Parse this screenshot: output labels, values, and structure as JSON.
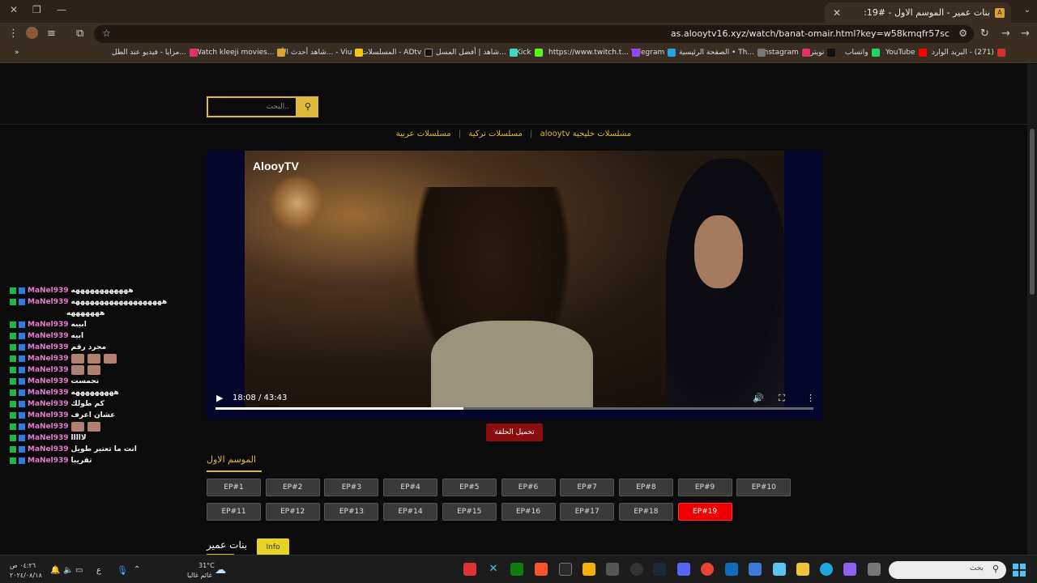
{
  "browser": {
    "tab_title": "بنات عمير - الموسم الاول - #19:",
    "tab_close": "✕",
    "new_tab": "+",
    "url": "as.alooytv16.xyz/watch/banat-omair.html?key=w58kmqfr57sc"
  },
  "bookmarks": [
    {
      "label": "البريد الوارد ‎- (271)",
      "color": "#d93025"
    },
    {
      "label": "YouTube",
      "color": "#ff0000"
    },
    {
      "label": "واتساب",
      "color": "#25d366"
    },
    {
      "label": "تويتر",
      "color": "#111111"
    },
    {
      "label": "Instagram",
      "color": "#e1306c"
    },
    {
      "label": "الصفحة الرئيسية • Th...",
      "color": "#777777"
    },
    {
      "label": "Telegram",
      "color": "#2aa3df"
    },
    {
      "label": "https://www.twitch.t...",
      "color": "#9146ff"
    },
    {
      "label": "Kick",
      "color": "#53fc18"
    },
    {
      "label": "شاهد | أفضل المسل...",
      "color": "#3cd7c5"
    },
    {
      "label": "المسلسلات - ADtv",
      "color": "#111111"
    },
    {
      "label": "شاهد أحدث الأع... - Viu",
      "color": "#f5c518"
    },
    {
      "label": "Watch kleeji movies...",
      "color": "#d8a534"
    },
    {
      "label": "مزايا - فيديو عند الطل...",
      "color": "#e1306c"
    }
  ],
  "site": {
    "search_placeholder": "البحث..",
    "search_icon": "🔍",
    "crumbs": [
      "alooytv مسلسلات خليجية",
      "مسلسلات عربية",
      "مسلسلات تركية"
    ],
    "crumb_sep": "|"
  },
  "video": {
    "logo": "AlooyTV",
    "time": "18:08 / 43:43",
    "progress": 0.414,
    "play_icon": "▶",
    "volume_icon": "🔊",
    "fullscreen_icon": "⛶",
    "more_icon": "⋮"
  },
  "download_label": "تحميل الحلقة",
  "season_title": "الموسم الاول",
  "episodes": [
    "EP#1",
    "EP#2",
    "EP#3",
    "EP#4",
    "EP#5",
    "EP#6",
    "EP#7",
    "EP#8",
    "EP#9",
    "EP#10",
    "EP#11",
    "EP#12",
    "EP#13",
    "EP#14",
    "EP#15",
    "EP#16",
    "EP#17",
    "EP#18",
    "EP#19"
  ],
  "active_episode": "EP#19",
  "show_title": "بنات عمير",
  "info_label": "Info",
  "chat": [
    {
      "user": "MaNel939",
      "text": "ههههههههههههه",
      "emotes": 0
    },
    {
      "user": "MaNel939",
      "text": "هههههههههههههههههههه",
      "emotes": 0
    },
    {
      "user": "",
      "text": "هههههههه",
      "emotes": 0
    },
    {
      "user": "MaNel939",
      "text": "ابيبه",
      "emotes": 0
    },
    {
      "user": "MaNel939",
      "text": "ابيه",
      "emotes": 0
    },
    {
      "user": "MaNel939",
      "text": "مجرد رقم",
      "emotes": 0
    },
    {
      "user": "MaNel939",
      "text": "",
      "emotes": 3
    },
    {
      "user": "MaNel939",
      "text": "",
      "emotes": 2
    },
    {
      "user": "MaNel939",
      "text": "تحمست",
      "emotes": 0
    },
    {
      "user": "MaNel939",
      "text": "هههههههههه",
      "emotes": 0
    },
    {
      "user": "MaNel939",
      "text": "كم طولك",
      "emotes": 0
    },
    {
      "user": "MaNel939",
      "text": "عشان اعرف",
      "emotes": 0
    },
    {
      "user": "MaNel939",
      "text": "",
      "emotes": 2
    },
    {
      "user": "MaNel939",
      "text": "لااااا",
      "emotes": 0
    },
    {
      "user": "MaNel939",
      "text": "انت ما تعتبر طويل",
      "emotes": 0
    },
    {
      "user": "MaNel939",
      "text": "تقريبا",
      "emotes": 0
    }
  ],
  "taskbar": {
    "search_label": "بحث",
    "weather_temp": "31°C",
    "weather_desc": "غائم غالبا",
    "clock_time": "٠٤:٢٦ ص",
    "clock_date": "٢٠٢٤/٠٨/١٨",
    "lang": "ع"
  }
}
